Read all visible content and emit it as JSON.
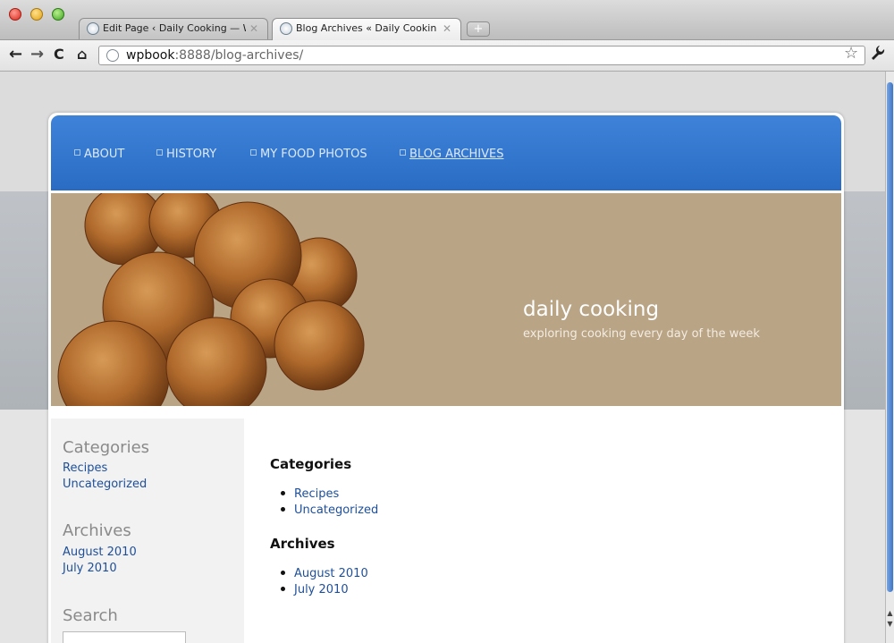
{
  "browser": {
    "tabs": [
      {
        "label": "Edit Page ‹ Daily Cooking — W"
      },
      {
        "label": "Blog Archives « Daily Cookin"
      }
    ],
    "new_tab_label": "+",
    "url_host": "wpbook",
    "url_rest": ":8888/blog-archives/"
  },
  "nav": {
    "items": [
      {
        "label": "ABOUT"
      },
      {
        "label": "HISTORY"
      },
      {
        "label": "MY FOOD PHOTOS"
      },
      {
        "label": "BLOG ARCHIVES"
      }
    ]
  },
  "header": {
    "title": "daily cooking",
    "description": "exploring cooking every day of the week"
  },
  "sidebar": {
    "categories_heading": "Categories",
    "categories": [
      "Recipes",
      "Uncategorized"
    ],
    "archives_heading": "Archives",
    "archives": [
      "August 2010",
      "July 2010"
    ],
    "search_heading": "Search"
  },
  "main": {
    "categories_heading": "Categories",
    "categories": [
      "Recipes",
      "Uncategorized"
    ],
    "archives_heading": "Archives",
    "archives": [
      "August 2010",
      "July 2010"
    ]
  },
  "colors": {
    "nav_blue": "#2f74cf",
    "header_tan": "#b9a485",
    "link_blue": "#1d4f9b"
  }
}
